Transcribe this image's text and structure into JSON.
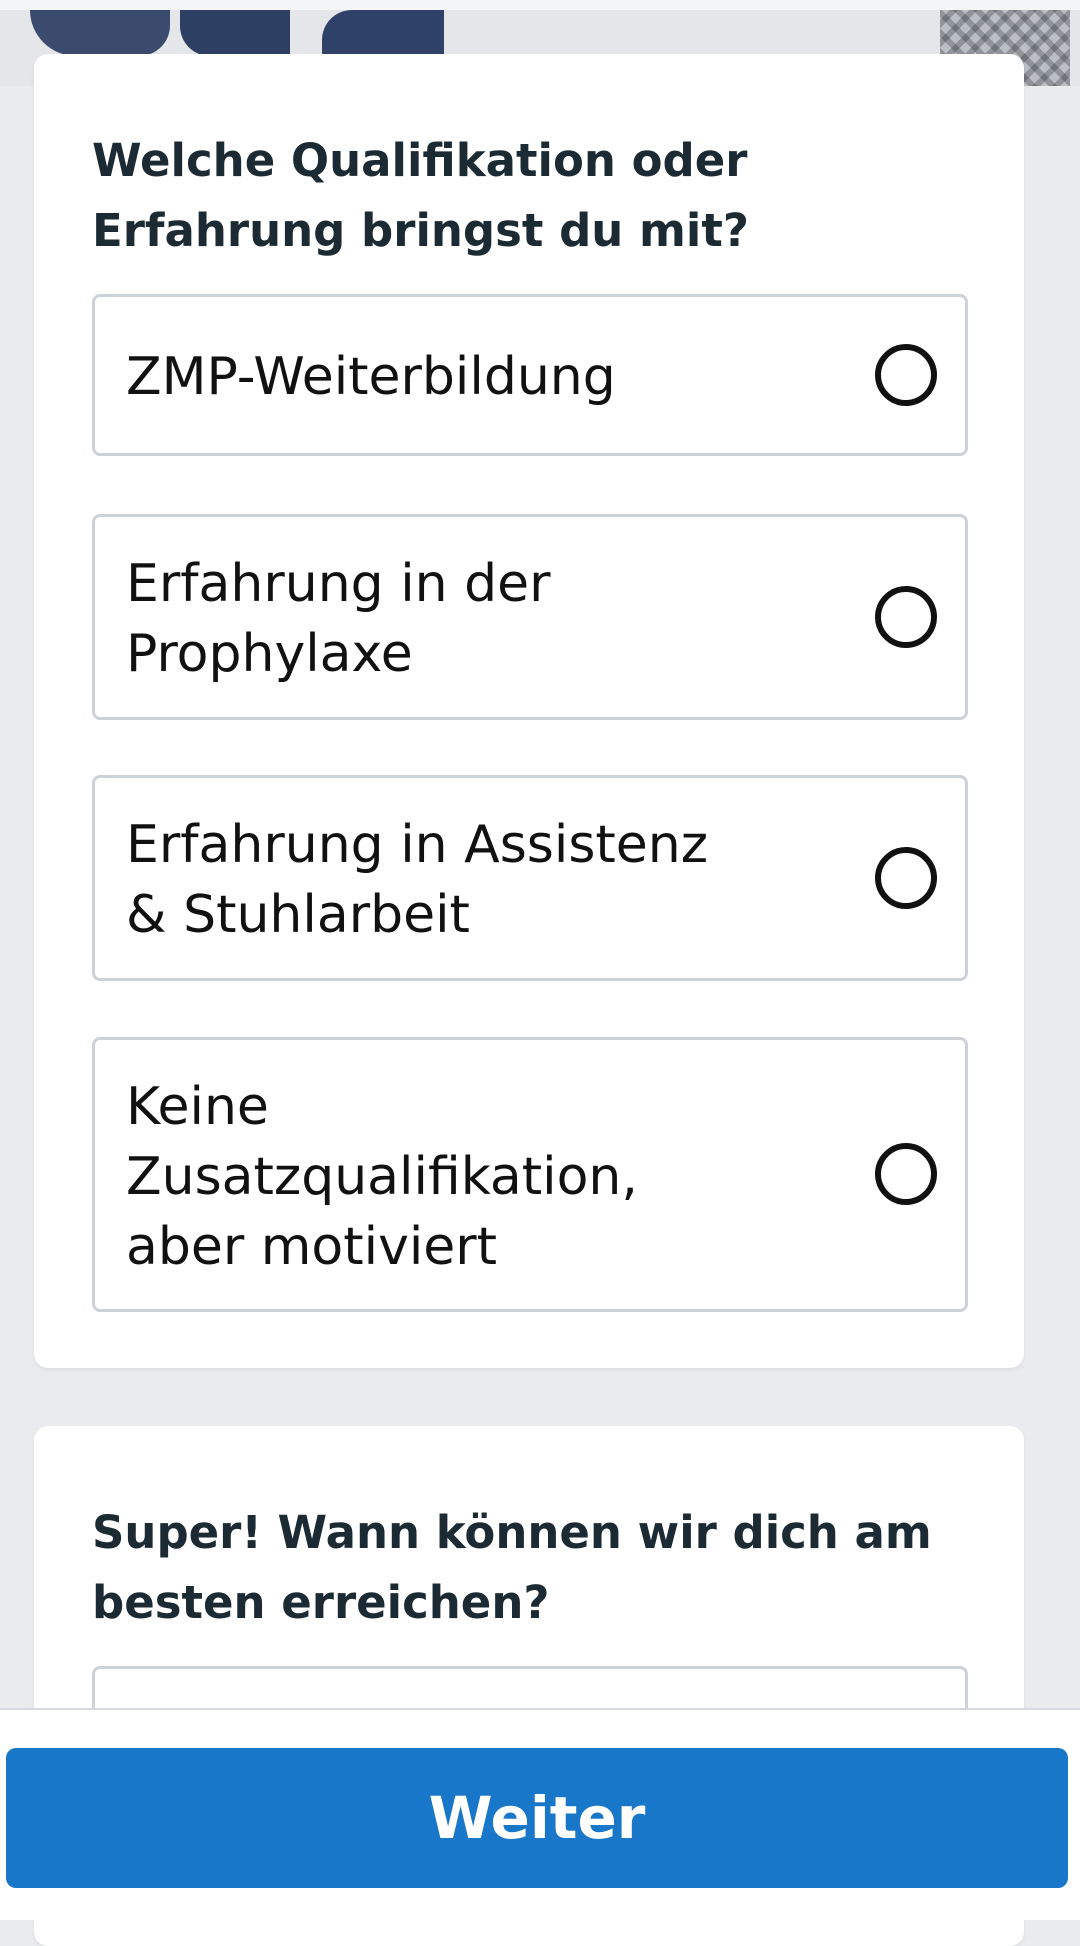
{
  "colors": {
    "page_background": "#e9ebee",
    "card_background": "#ffffff",
    "option_border": "#cdd2d9",
    "question_text": "#1c2b33",
    "primary_button": "#1877c9",
    "primary_button_text": "#ffffff"
  },
  "qualification_card": {
    "question": "Welche Qualifikation oder Erfahrung bringst du mit?",
    "options": [
      {
        "label": "ZMP-Weiterbildung",
        "selected": false
      },
      {
        "label": "Erfahrung in der\nProphylaxe",
        "selected": false
      },
      {
        "label": "Erfahrung in Assistenz\n& Stuhlarbeit",
        "selected": false
      },
      {
        "label": "Keine\nZusatzqualifikation,\naber motiviert",
        "selected": false
      }
    ]
  },
  "contact_card": {
    "question": "Super! Wann können wir dich am besten erreichen?"
  },
  "footer": {
    "next_label": "Weiter"
  }
}
